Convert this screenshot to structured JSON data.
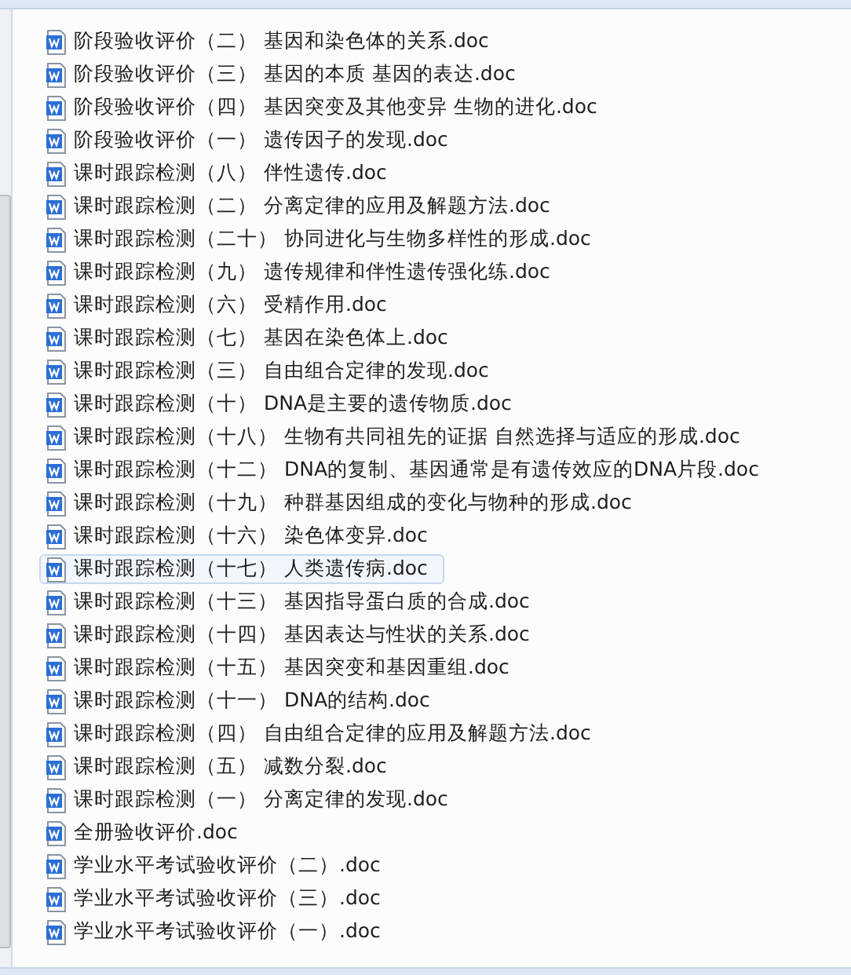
{
  "files": [
    {
      "name": "阶段验收评价（二） 基因和染色体的关系.doc",
      "selected": false
    },
    {
      "name": "阶段验收评价（三） 基因的本质  基因的表达.doc",
      "selected": false
    },
    {
      "name": "阶段验收评价（四） 基因突变及其他变异  生物的进化.doc",
      "selected": false
    },
    {
      "name": "阶段验收评价（一） 遗传因子的发现.doc",
      "selected": false
    },
    {
      "name": "课时跟踪检测（八） 伴性遗传.doc",
      "selected": false
    },
    {
      "name": "课时跟踪检测（二） 分离定律的应用及解题方法.doc",
      "selected": false
    },
    {
      "name": "课时跟踪检测（二十） 协同进化与生物多样性的形成.doc",
      "selected": false
    },
    {
      "name": "课时跟踪检测（九） 遗传规律和伴性遗传强化练.doc",
      "selected": false
    },
    {
      "name": "课时跟踪检测（六） 受精作用.doc",
      "selected": false
    },
    {
      "name": "课时跟踪检测（七） 基因在染色体上.doc",
      "selected": false
    },
    {
      "name": "课时跟踪检测（三） 自由组合定律的发现.doc",
      "selected": false
    },
    {
      "name": "课时跟踪检测（十） DNA是主要的遗传物质.doc",
      "selected": false
    },
    {
      "name": "课时跟踪检测（十八） 生物有共同祖先的证据  自然选择与适应的形成.doc",
      "selected": false
    },
    {
      "name": "课时跟踪检测（十二） DNA的复制、基因通常是有遗传效应的DNA片段.doc",
      "selected": false
    },
    {
      "name": "课时跟踪检测（十九） 种群基因组成的变化与物种的形成.doc",
      "selected": false
    },
    {
      "name": "课时跟踪检测（十六） 染色体变异.doc",
      "selected": false
    },
    {
      "name": "课时跟踪检测（十七） 人类遗传病.doc",
      "selected": true
    },
    {
      "name": "课时跟踪检测（十三） 基因指导蛋白质的合成.doc",
      "selected": false
    },
    {
      "name": "课时跟踪检测（十四） 基因表达与性状的关系.doc",
      "selected": false
    },
    {
      "name": "课时跟踪检测（十五） 基因突变和基因重组.doc",
      "selected": false
    },
    {
      "name": "课时跟踪检测（十一） DNA的结构.doc",
      "selected": false
    },
    {
      "name": "课时跟踪检测（四） 自由组合定律的应用及解题方法.doc",
      "selected": false
    },
    {
      "name": "课时跟踪检测（五） 减数分裂.doc",
      "selected": false
    },
    {
      "name": "课时跟踪检测（一） 分离定律的发现.doc",
      "selected": false
    },
    {
      "name": "全册验收评价.doc",
      "selected": false
    },
    {
      "name": "学业水平考试验收评价（二）.doc",
      "selected": false
    },
    {
      "name": "学业水平考试验收评价（三）.doc",
      "selected": false
    },
    {
      "name": "学业水平考试验收评价（一）.doc",
      "selected": false
    }
  ]
}
